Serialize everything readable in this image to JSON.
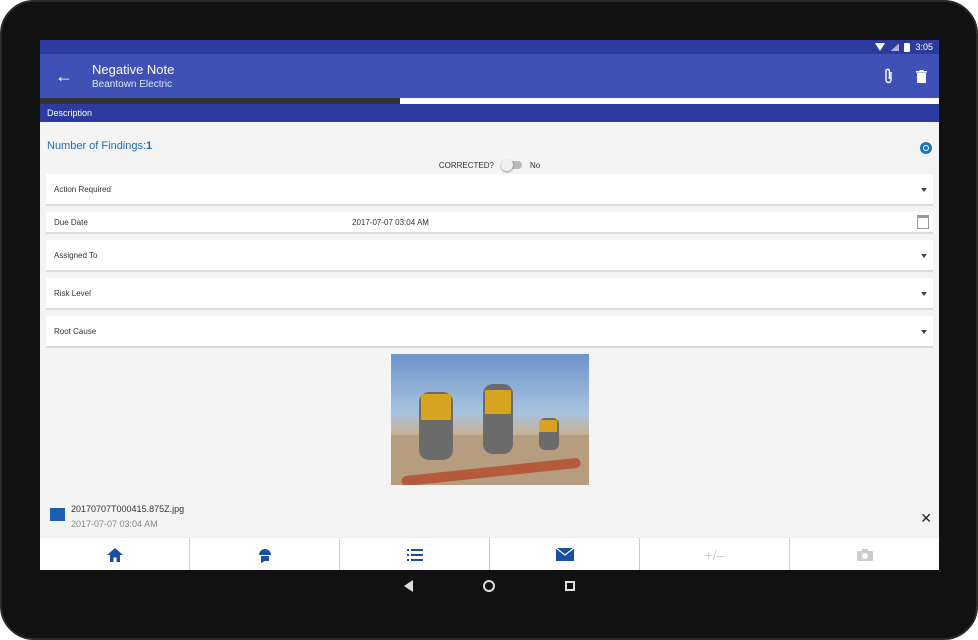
{
  "status_bar": {
    "time": "3:05"
  },
  "appbar": {
    "title": "Negative Note",
    "subtitle": "Beantown Electric"
  },
  "progress_fraction": 0.4,
  "tab_label": "Description",
  "findings": {
    "label": "Number of Findings:",
    "count": "1"
  },
  "corrected": {
    "label": "CORRECTED?",
    "value": "No"
  },
  "fields": {
    "action_required": "Action Required",
    "due_date_label": "Due Date",
    "due_date_value": "2017-07-07 03:04 AM",
    "assigned_to": "Assigned To",
    "risk_level": "Risk Level",
    "root_cause": "Root Cause"
  },
  "attachment": {
    "filename": "20170707T000415.875Z.jpg",
    "date": "2017-07-07 03:04 AM"
  },
  "colors": {
    "primary": "#3f51b5",
    "primary_dark": "#2d3a9e",
    "accent": "#1f6fb6"
  },
  "icons": [
    "back-arrow-icon",
    "attachment-icon",
    "delete-icon",
    "search-icon",
    "calendar-icon",
    "image-icon",
    "close-icon",
    "home-icon",
    "worker-head-icon",
    "list-icon",
    "mail-icon",
    "plus-minus-icon",
    "camera-icon"
  ]
}
